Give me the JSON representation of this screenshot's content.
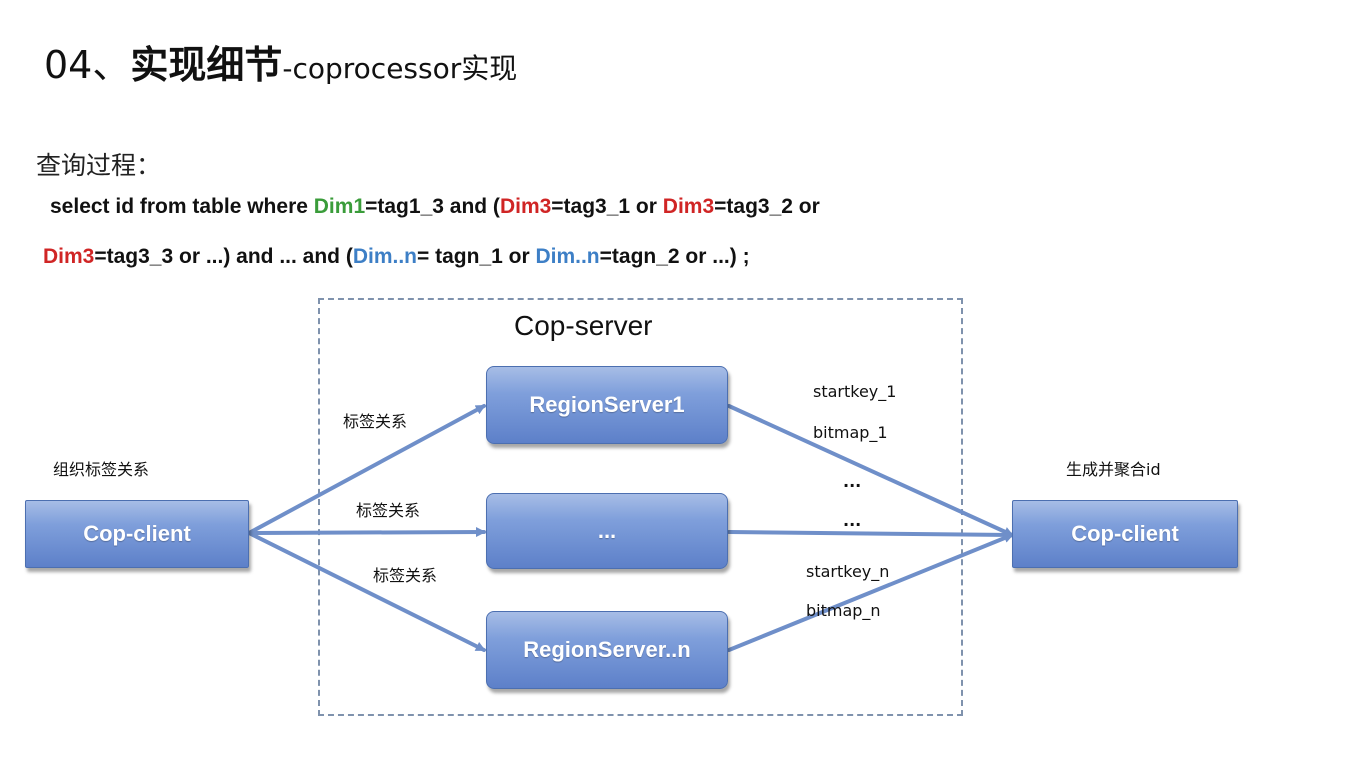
{
  "title": {
    "number": "04、",
    "main": "实现细节",
    "rest": "-coprocessor实现"
  },
  "subtitle": "查询过程：",
  "query": {
    "line1": [
      {
        "text": "select id from table where ",
        "color": "default"
      },
      {
        "text": "Dim1",
        "color": "green"
      },
      {
        "text": "=tag1_3 and  (",
        "color": "default"
      },
      {
        "text": "Dim3",
        "color": "red"
      },
      {
        "text": "=tag3_1 or ",
        "color": "default"
      },
      {
        "text": "Dim3",
        "color": "red"
      },
      {
        "text": "=tag3_2 or",
        "color": "default"
      }
    ],
    "line2": [
      {
        "text": "Dim3",
        "color": "red"
      },
      {
        "text": "=tag3_3 or ...) and  ... and (",
        "color": "default"
      },
      {
        "text": "Dim..n",
        "color": "blue"
      },
      {
        "text": "= tagn_1 or ",
        "color": "default"
      },
      {
        "text": "Dim..n",
        "color": "blue"
      },
      {
        "text": "=tagn_2 or ...) ;",
        "color": "default"
      }
    ]
  },
  "colors": {
    "green": "#3a9c3a",
    "red": "#d02525",
    "blue": "#3d7fc6",
    "arrow": "#6f8fc9",
    "node": "#7f9fdb"
  },
  "diagram": {
    "server_group_label": "Cop-server",
    "left_caption": "组织标签关系",
    "right_caption": "生成并聚合id",
    "client_left": "Cop-client",
    "client_right": "Cop-client",
    "region1": "RegionServer1",
    "region_mid": "...",
    "region_n": "RegionServer..n",
    "edge_labels": [
      "标签关系",
      "标签关系",
      "标签关系"
    ],
    "startkey_1": "startkey_1",
    "bitmap_1": "bitmap_1",
    "dots_1": "...",
    "dots_2": "...",
    "startkey_n": "startkey_n",
    "bitmap_n": "bitmap_n"
  }
}
